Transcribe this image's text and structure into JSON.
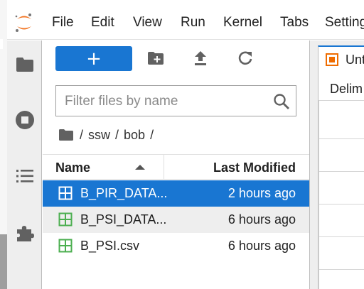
{
  "menu": {
    "items": [
      "File",
      "Edit",
      "View",
      "Run",
      "Kernel",
      "Tabs",
      "Settings"
    ]
  },
  "activity_bar": {
    "items": [
      "folder-icon",
      "stop-circle-icon",
      "list-icon",
      "puzzle-icon"
    ]
  },
  "file_browser": {
    "new_button_label": "+",
    "filter_placeholder": "Filter files by name",
    "breadcrumb": [
      "ssw",
      "bob"
    ],
    "columns": {
      "name": "Name",
      "last_modified": "Last Modified"
    },
    "files": [
      {
        "name": "B_PIR_DATA...",
        "modified": "2 hours ago",
        "state": "selected"
      },
      {
        "name": "B_PSI_DATA...",
        "modified": "6 hours ago",
        "state": "hover"
      },
      {
        "name": "B_PSI.csv",
        "modified": "6 hours ago",
        "state": "normal"
      }
    ]
  },
  "main": {
    "tab_title": "Unt",
    "delimiter_label": "Delim"
  },
  "colors": {
    "accent": "#1976d2",
    "csv_icon": "#4caf50",
    "logo_orange": "#f37726",
    "tab_icon_orange": "#ef6c00"
  }
}
